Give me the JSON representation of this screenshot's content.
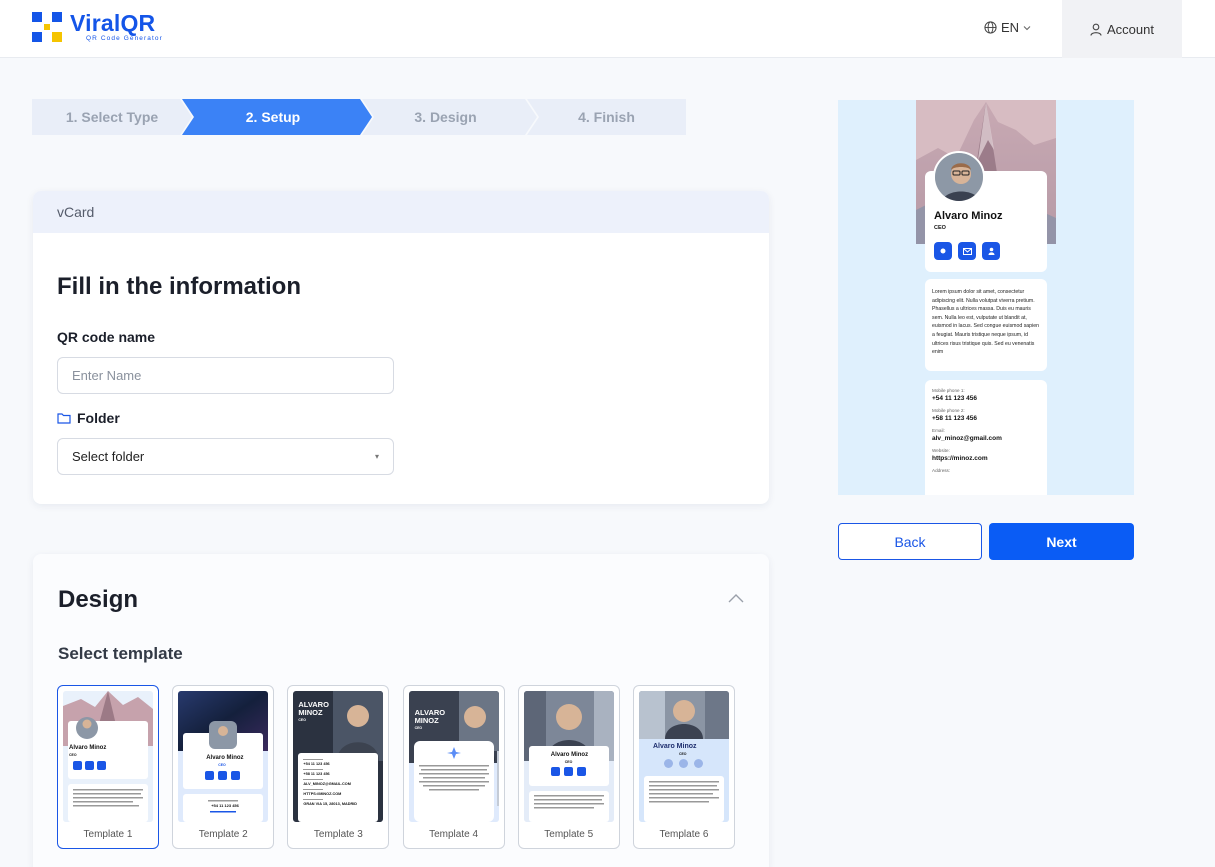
{
  "header": {
    "logo_title": "ViralQR",
    "logo_subtitle": "QR Code Generator",
    "language": "EN",
    "account_label": "Account"
  },
  "stepper": {
    "steps": [
      "1. Select Type",
      "2. Setup",
      "3. Design",
      "4. Finish"
    ],
    "active_index": 1
  },
  "vcard_card": {
    "header": "vCard",
    "title": "Fill in the information",
    "qr_name_label": "QR code name",
    "qr_name_placeholder": "Enter Name",
    "qr_name_value": "",
    "folder_label": "Folder",
    "folder_value": "Select folder"
  },
  "design_card": {
    "title": "Design",
    "select_template_label": "Select template",
    "templates": [
      "Template 1",
      "Template 2",
      "Template 3",
      "Template 4",
      "Template 5",
      "Template 6"
    ],
    "selected_template": "Template 1"
  },
  "preview": {
    "name": "Alvaro Minoz",
    "title": "CEO",
    "about": "Lorem ipsum dolor sit amet, consectetur adipiscing elit. Nulla volutpat viverra pretium. Phasellus a ultrices massa. Duis eu mauris sem. Nulla leo est, vulputate ut blandit at, euismod in lacus. Sed congue euismod sapien a feugiat. Mauris tristique neque ipsum, id ultrices risus tristique quis. Sed eu venenatis enim",
    "contacts": [
      {
        "key": "Mobile phone 1:",
        "value": "+54 11 123 456"
      },
      {
        "key": "Mobile phone 2:",
        "value": "+58 11 123 456"
      },
      {
        "key": "Email:",
        "value": "alv_minoz@gmail.com"
      },
      {
        "key": "Website:",
        "value": "https://minoz.com"
      },
      {
        "key": "Address:",
        "value": ""
      }
    ]
  },
  "actions": {
    "back_label": "Back",
    "next_label": "Next"
  },
  "colors": {
    "primary": "#0a5cf5",
    "brand_blue": "#1455e8",
    "logo_yellow": "#f5c400",
    "step_inactive": "#e9eef8"
  },
  "icons": [
    "globe-icon",
    "chevron-down-icon",
    "user-icon",
    "folder-icon",
    "chevron-up-icon",
    "phone-icon",
    "mail-icon",
    "contact-icon"
  ]
}
